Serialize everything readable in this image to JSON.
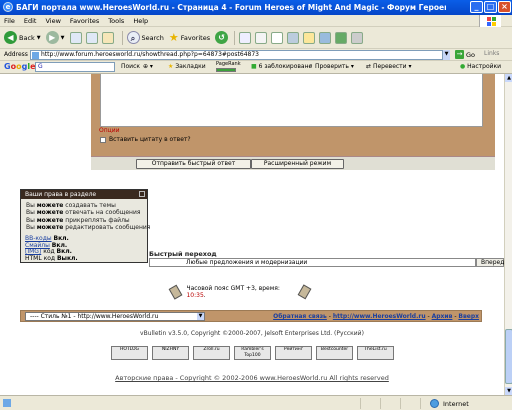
{
  "window": {
    "title": "БАГИ портала www.HeroesWorld.ru - Страница 4 - Forum Heroes of Might And Magic - Форум Героев М - Microsoft Internet Explorer",
    "icon_text": "e"
  },
  "menu": [
    "File",
    "Edit",
    "View",
    "Favorites",
    "Tools",
    "Help"
  ],
  "toolbar": {
    "back_label": "Back",
    "search_label": "Search",
    "favorites_label": "Favorites"
  },
  "address": {
    "label": "Address",
    "url": "http://www.forum.heroesworld.ru/showthread.php?p=64873#post64873",
    "go_label": "Go",
    "links_label": "Links"
  },
  "google_bar": {
    "logo": "Google",
    "search_label": "Поиск",
    "bookmarks_label": "Закладки",
    "pagerank_label": "PageRank",
    "blocked_label": "6 заблокировано",
    "check_label": "Проверить",
    "translate_label": "Перевести",
    "settings_label": "Настройки"
  },
  "reply": {
    "options_label": "Опции",
    "quote_label": "Вставить цитату в ответ?",
    "submit_label": "Отправить быстрый ответ",
    "advanced_label": "Расширенный режим"
  },
  "permissions": {
    "title": "Ваши права в разделе",
    "lines": [
      {
        "pre": "Вы ",
        "bold": "можете",
        "post": " создавать темы"
      },
      {
        "pre": "Вы ",
        "bold": "можете",
        "post": " отвечать на сообщения"
      },
      {
        "pre": "Вы ",
        "bold": "можете",
        "post": " прикреплять файлы"
      },
      {
        "pre": "Вы ",
        "bold": "можете",
        "post": " редактировать сообщения"
      }
    ],
    "codes": [
      {
        "name": "BB-коды",
        "state": "Вкл."
      },
      {
        "name": "Смайлы",
        "state": "Вкл."
      },
      {
        "name": "[IMG]",
        "mid": " код ",
        "state": "Вкл."
      },
      {
        "name": "HTML код",
        "state": "Выкл."
      }
    ]
  },
  "quick_jump": {
    "label": "Быстрый переход",
    "selected": "Любые предложения и модернизации",
    "go_label": "Вперед"
  },
  "timezone": {
    "text": "Часовой пояс GMT +3, время: ",
    "time": "10:35",
    "dot": "."
  },
  "footer": {
    "style_select": "---- Стиль №1 - http://www.HeroesWorld.ru",
    "feedback": "Обратная связь",
    "site": "http://www.HeroesWorld.ru",
    "archive": "Архив",
    "top": "Вверх",
    "separator": " - "
  },
  "vbulletin": "vBulletin v3.5.0, Copyright ©2000-2007, Jelsoft Enterprises Ltd. (Русский)",
  "badges": [
    "HOTLOG",
    "NIZHNY",
    "Zroll.ru",
    "Rambler's Top100",
    "Рейтинг",
    "Bestcounter",
    "TheList.ru"
  ],
  "copyright": "Авторские права - Copyright © 2002-2006 www.HeroesWorld.ru All rights reserved",
  "status": {
    "zone": "Internet"
  }
}
